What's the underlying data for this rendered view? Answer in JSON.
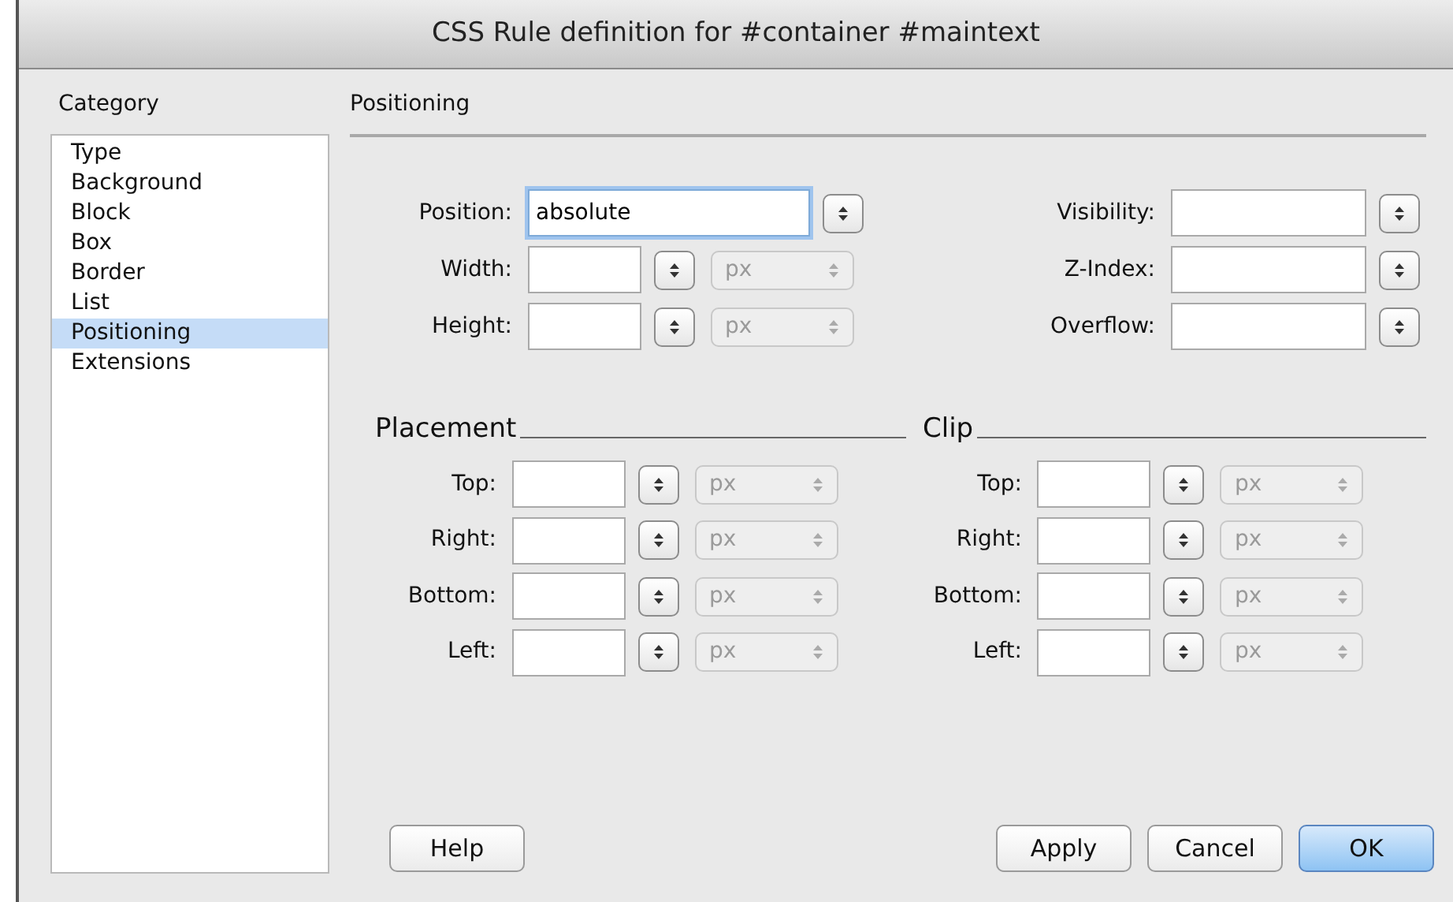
{
  "window": {
    "title": "CSS Rule definition for #container #maintext"
  },
  "category": {
    "label": "Category",
    "items": [
      {
        "label": "Type",
        "selected": false
      },
      {
        "label": "Background",
        "selected": false
      },
      {
        "label": "Block",
        "selected": false
      },
      {
        "label": "Box",
        "selected": false
      },
      {
        "label": "Border",
        "selected": false
      },
      {
        "label": "List",
        "selected": false
      },
      {
        "label": "Positioning",
        "selected": true
      },
      {
        "label": "Extensions",
        "selected": false
      }
    ]
  },
  "panel": {
    "title": "Positioning",
    "fields_left": [
      {
        "label": "Position:",
        "value": "absolute",
        "focused": true,
        "wide": true
      },
      {
        "label": "Width:",
        "focused": false,
        "unit": "px",
        "unit_disabled": true
      },
      {
        "label": "Height:",
        "focused": false,
        "unit": "px",
        "unit_disabled": true
      }
    ],
    "fields_right": [
      {
        "label": "Visibility:",
        "focused": false
      },
      {
        "label": "Z-Index:",
        "focused": false
      },
      {
        "label": "Overflow:",
        "focused": false
      }
    ],
    "groups": [
      {
        "title": "Placement",
        "fields": [
          {
            "label": "Top:",
            "unit": "px",
            "unit_disabled": true
          },
          {
            "label": "Right:",
            "unit": "px",
            "unit_disabled": true
          },
          {
            "label": "Bottom:",
            "unit": "px",
            "unit_disabled": true
          },
          {
            "label": "Left:",
            "unit": "px",
            "unit_disabled": true
          }
        ]
      },
      {
        "title": "Clip",
        "fields": [
          {
            "label": "Top:",
            "unit": "px",
            "unit_disabled": true
          },
          {
            "label": "Right:",
            "unit": "px",
            "unit_disabled": true
          },
          {
            "label": "Bottom:",
            "unit": "px",
            "unit_disabled": true
          },
          {
            "label": "Left:",
            "unit": "px",
            "unit_disabled": true
          }
        ]
      }
    ]
  },
  "buttons_left": [
    {
      "label": "Help",
      "default": false
    }
  ],
  "buttons_right": [
    {
      "label": "Apply",
      "default": false
    },
    {
      "label": "Cancel",
      "default": false
    },
    {
      "label": "OK",
      "default": true
    }
  ]
}
